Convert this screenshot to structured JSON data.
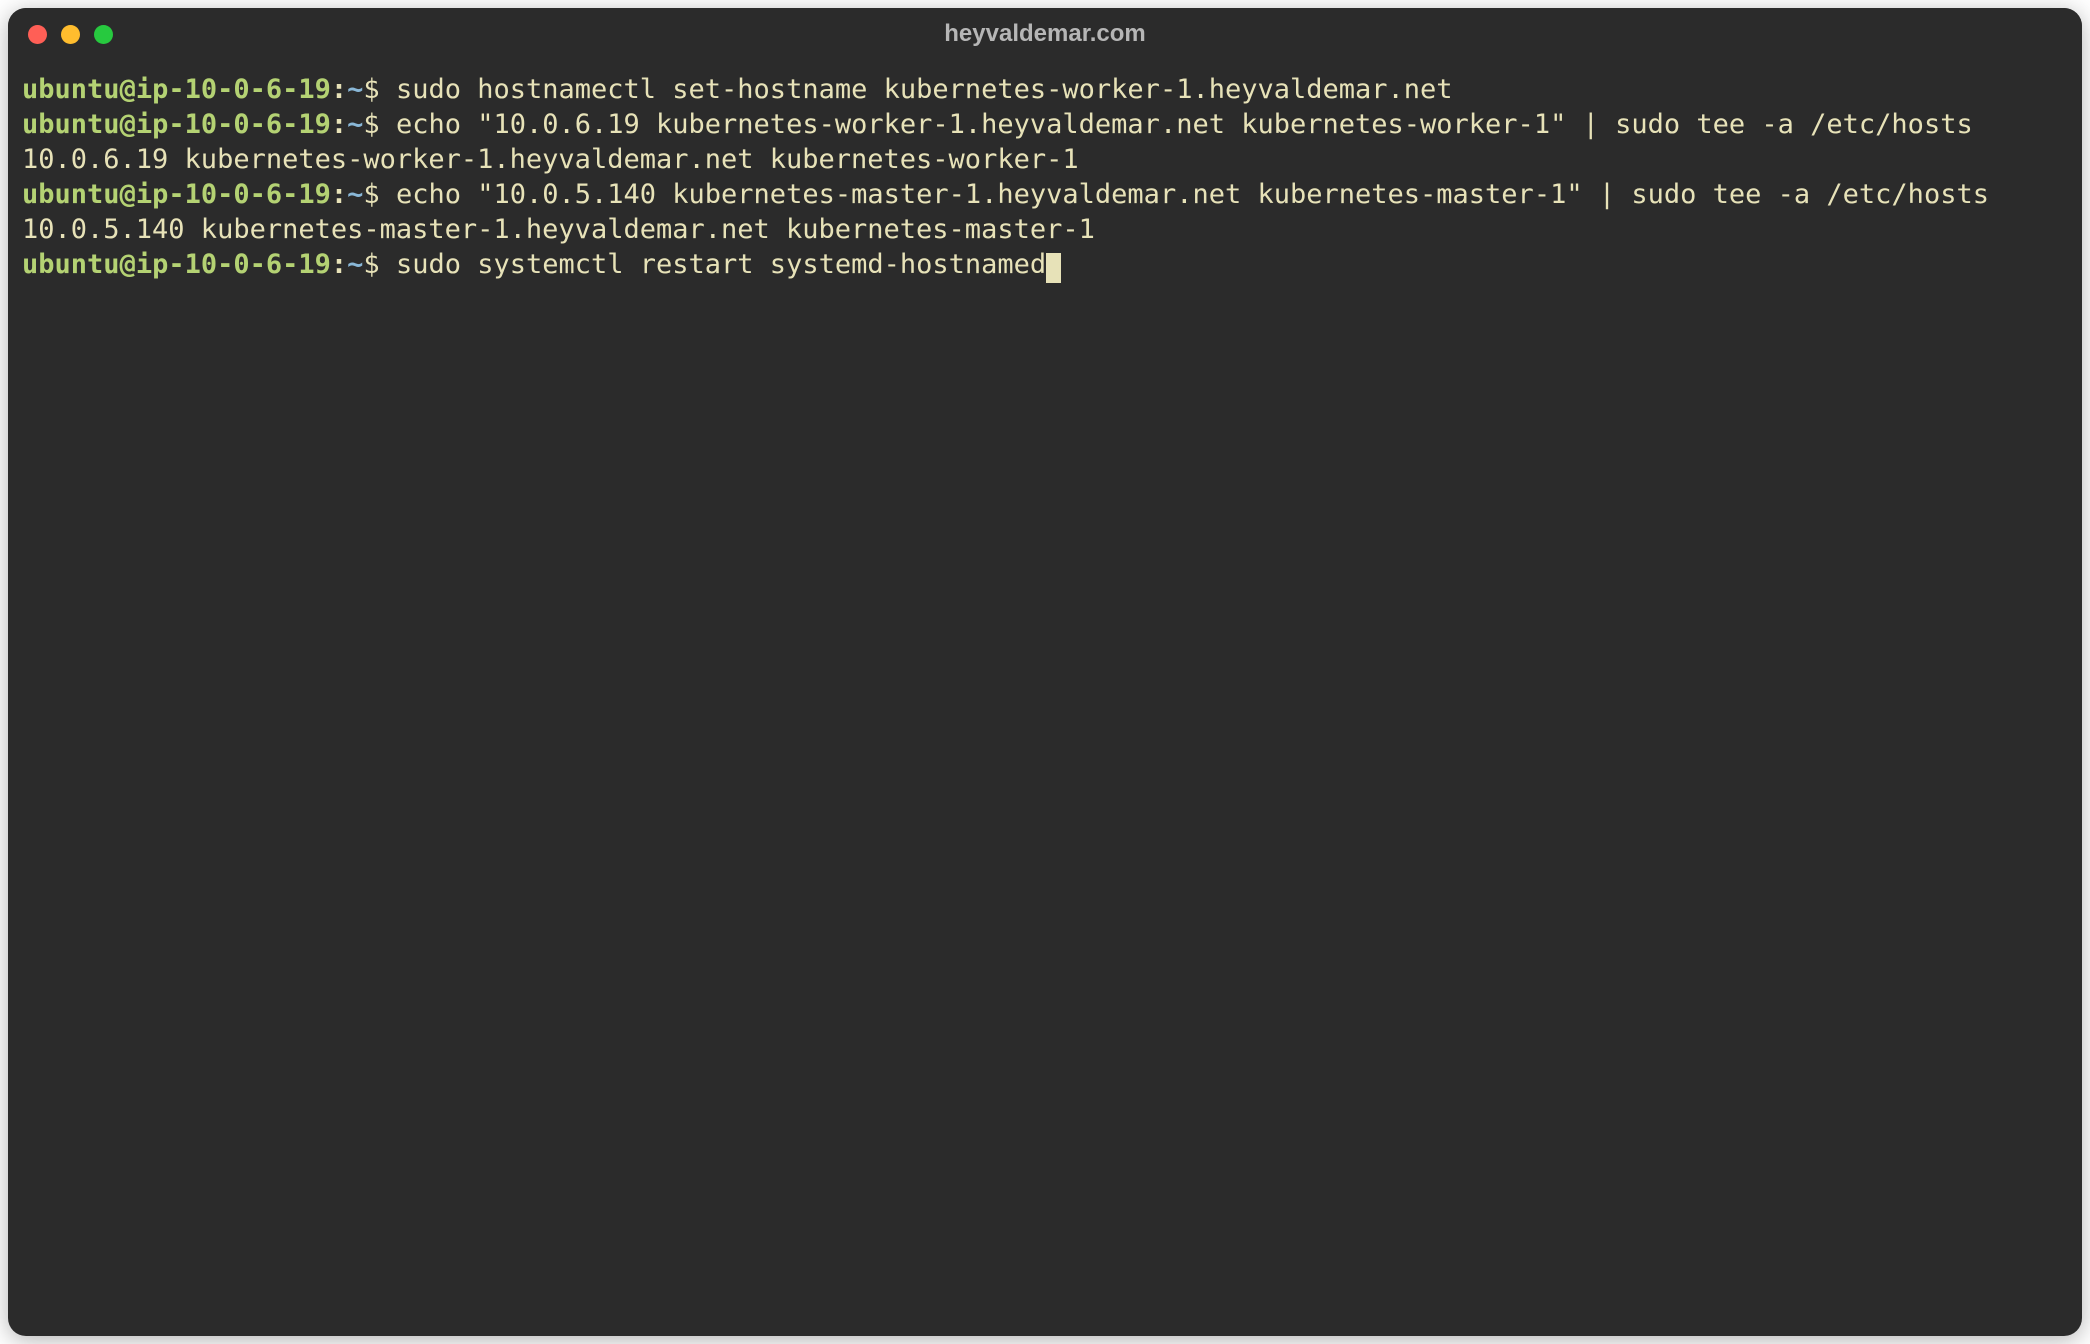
{
  "title": "heyvaldemar.com",
  "prompt": {
    "user": "ubuntu",
    "at": "@",
    "host": "ip-10-0-6-19",
    "colon": ":",
    "path": "~",
    "symbol": "$"
  },
  "lines": [
    {
      "type": "cmd",
      "text": "sudo hostnamectl set-hostname kubernetes-worker-1.heyvaldemar.net"
    },
    {
      "type": "cmd",
      "text": "echo \"10.0.6.19 kubernetes-worker-1.heyvaldemar.net kubernetes-worker-1\" | sudo tee -a /etc/hosts"
    },
    {
      "type": "out",
      "text": "10.0.6.19 kubernetes-worker-1.heyvaldemar.net kubernetes-worker-1"
    },
    {
      "type": "cmd",
      "text": "echo \"10.0.5.140 kubernetes-master-1.heyvaldemar.net kubernetes-master-1\" | sudo tee -a /etc/hosts"
    },
    {
      "type": "out",
      "text": "10.0.5.140 kubernetes-master-1.heyvaldemar.net kubernetes-master-1"
    },
    {
      "type": "cmd",
      "text": "sudo systemctl restart systemd-hostnamed",
      "cursor": true
    }
  ]
}
